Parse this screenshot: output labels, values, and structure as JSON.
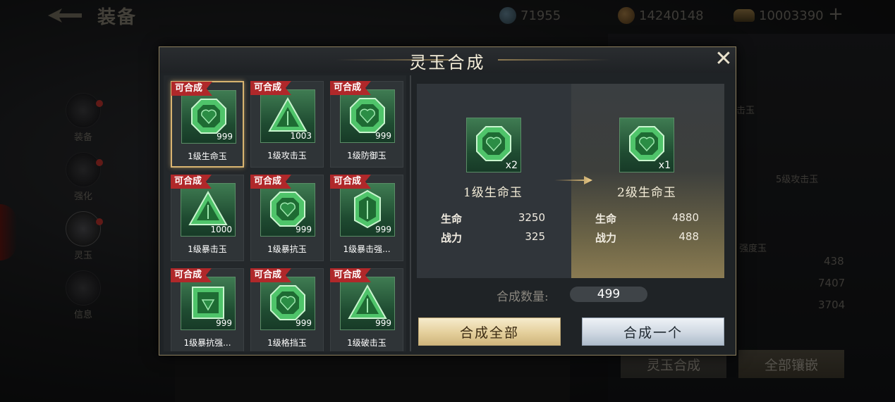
{
  "header": {
    "title": "装备",
    "currencies": [
      {
        "icon": "diamond-icon",
        "value": "71955"
      },
      {
        "icon": "coin-icon",
        "value": "14240148"
      },
      {
        "icon": "gold-ingot-icon",
        "value": "10003390"
      }
    ],
    "plus_label": "+"
  },
  "nav": {
    "items": [
      {
        "label": "装备"
      },
      {
        "label": "强化"
      },
      {
        "label": "灵玉"
      },
      {
        "label": "信息"
      }
    ]
  },
  "right_panel": {
    "slot_labels": [
      "击玉",
      "5级攻击玉",
      "强度玉"
    ],
    "numbers": [
      "438",
      "7407",
      "3704"
    ],
    "buttons": [
      "灵玉合成",
      "全部镶嵌"
    ]
  },
  "modal": {
    "title": "灵玉合成",
    "close_label": "✕",
    "badge": "可合成",
    "items": [
      {
        "name": "1级生命玉",
        "qty": "999",
        "shape": "octagon",
        "selected": true
      },
      {
        "name": "1级攻击玉",
        "qty": "1003",
        "shape": "triangle"
      },
      {
        "name": "1级防御玉",
        "qty": "999",
        "shape": "octagon"
      },
      {
        "name": "1级暴击玉",
        "qty": "1000",
        "shape": "triangle"
      },
      {
        "name": "1级暴抗玉",
        "qty": "999",
        "shape": "octagon"
      },
      {
        "name": "1级暴击强...",
        "qty": "999",
        "shape": "hexagon"
      },
      {
        "name": "1级暴抗强...",
        "qty": "999",
        "shape": "square"
      },
      {
        "name": "1级格挡玉",
        "qty": "999",
        "shape": "octagon"
      },
      {
        "name": "1级破击玉",
        "qty": "999",
        "shape": "triangle"
      }
    ],
    "source": {
      "name": "1级生命玉",
      "multiplier": "x2",
      "stats": [
        {
          "label": "生命",
          "value": "3250"
        },
        {
          "label": "战力",
          "value": "325"
        }
      ]
    },
    "target": {
      "name": "2级生命玉",
      "multiplier": "x1",
      "stats": [
        {
          "label": "生命",
          "value": "4880"
        },
        {
          "label": "战力",
          "value": "488"
        }
      ]
    },
    "quantity_label": "合成数量:",
    "quantity_value": "499",
    "btn_all": "合成全部",
    "btn_one": "合成一个"
  }
}
